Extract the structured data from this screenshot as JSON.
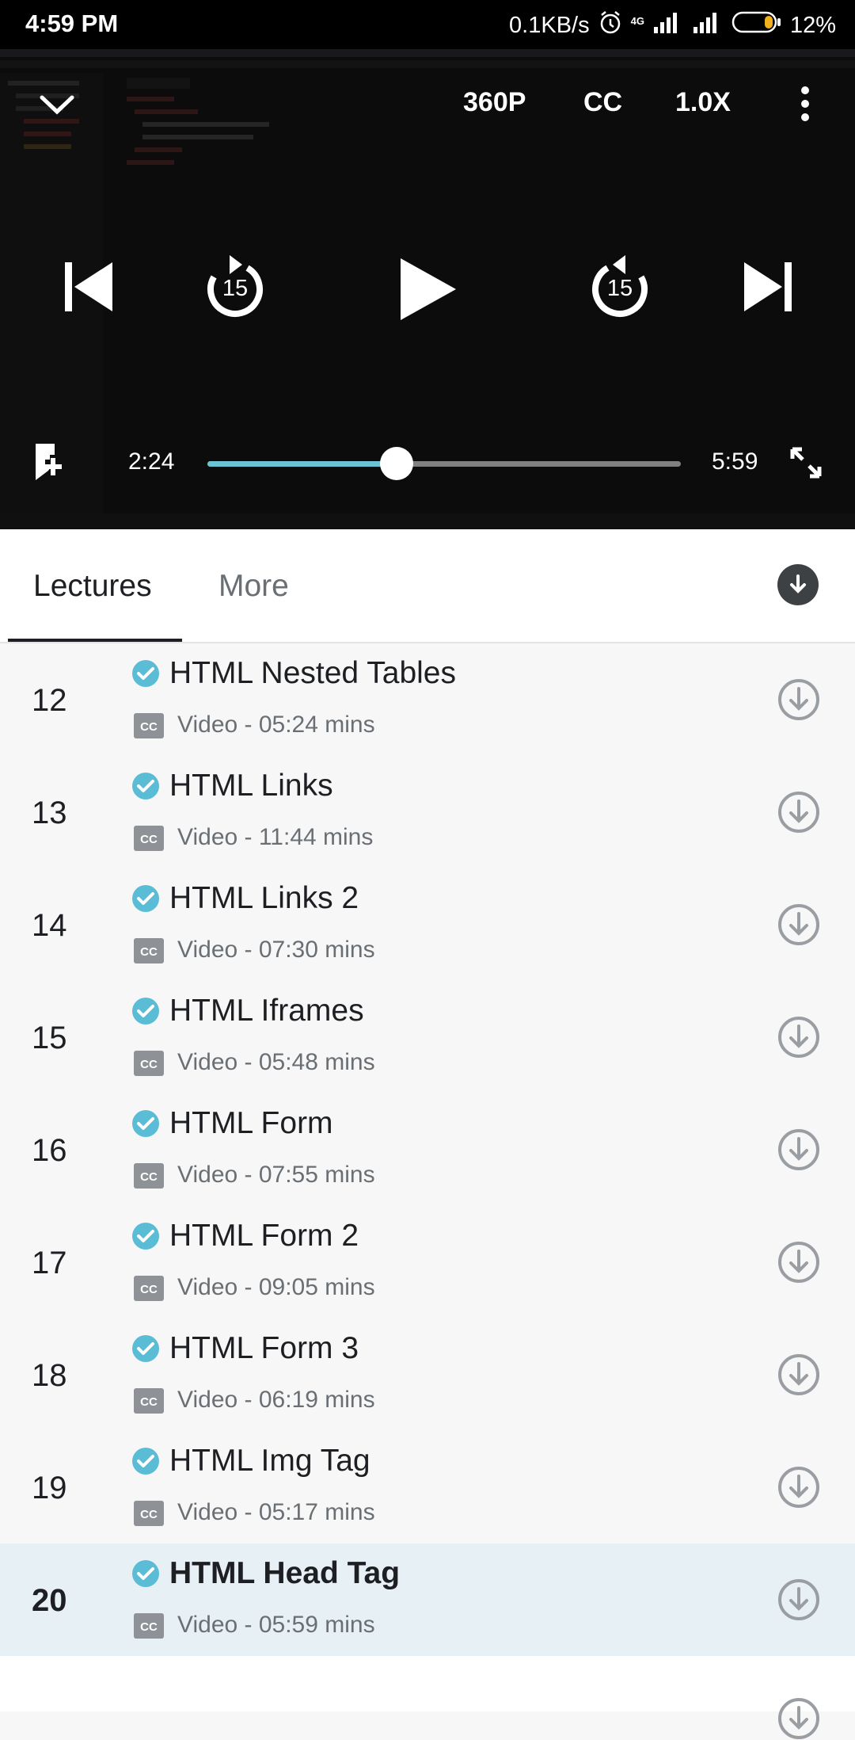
{
  "status_bar": {
    "time": "4:59 PM",
    "network_speed": "0.1KB/s",
    "network_type": "4G",
    "battery": "12%"
  },
  "player": {
    "quality": "360P",
    "captions": "CC",
    "speed": "1.0X",
    "rewind_seconds": "15",
    "forward_seconds": "15",
    "current_time": "2:24",
    "duration": "5:59",
    "progress": 0.4,
    "accent_color": "#6bc3d4"
  },
  "tabs": {
    "lectures": "Lectures",
    "more": "More"
  },
  "lectures": [
    {
      "number": "12",
      "title": "HTML Nested Tables",
      "meta": "Video - 05:24 mins",
      "completed": true
    },
    {
      "number": "13",
      "title": "HTML Links",
      "meta": "Video - 11:44 mins",
      "completed": true
    },
    {
      "number": "14",
      "title": "HTML Links 2",
      "meta": "Video - 07:30 mins",
      "completed": true
    },
    {
      "number": "15",
      "title": "HTML Iframes",
      "meta": "Video - 05:48 mins",
      "completed": true
    },
    {
      "number": "16",
      "title": "HTML Form",
      "meta": "Video - 07:55 mins",
      "completed": true
    },
    {
      "number": "17",
      "title": "HTML Form 2",
      "meta": "Video - 09:05 mins",
      "completed": true
    },
    {
      "number": "18",
      "title": "HTML Form 3",
      "meta": "Video - 06:19 mins",
      "completed": true
    },
    {
      "number": "19",
      "title": "HTML Img Tag",
      "meta": "Video - 05:17 mins",
      "completed": true
    },
    {
      "number": "20",
      "title": "HTML Head Tag",
      "meta": "Video - 05:59 mins",
      "completed": true,
      "active": true
    }
  ],
  "colors": {
    "check": "#5bbcd6",
    "active_row": "#e6f0f5",
    "text_primary": "#1d1f23",
    "text_secondary": "#6a6f73"
  }
}
